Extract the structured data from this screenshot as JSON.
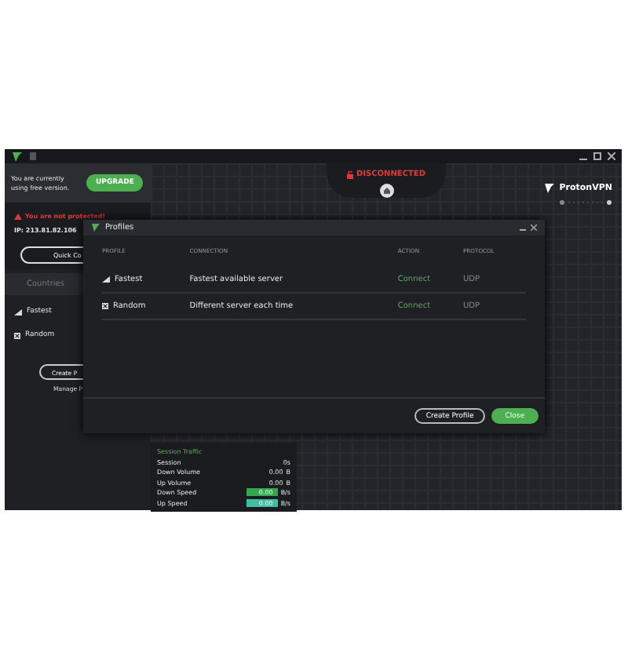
{
  "banner": {
    "text": "You are currently using free version.",
    "button": "UPGRADE"
  },
  "status": {
    "warning": "You are not protected!",
    "ip": "IP: 213.81.82.106",
    "quick_connect": "Quick Co"
  },
  "sidebar": {
    "tabs": [
      {
        "label": "Countries",
        "selected": false
      }
    ],
    "profiles": [
      {
        "name": "Fastest",
        "kind": "fastest"
      },
      {
        "name": "Random",
        "kind": "random"
      }
    ],
    "create_button": "Create P",
    "manage_link": "Manage P"
  },
  "connection": {
    "status": "DISCONNECTED"
  },
  "brand": "ProtonVPN",
  "stats": {
    "title": "Session Traffic",
    "rows": [
      {
        "label": "Session",
        "value": "0s",
        "kind": "plain"
      },
      {
        "label": "Down Volume",
        "value": "0.00",
        "unit": "B",
        "kind": "plain"
      },
      {
        "label": "Up Volume",
        "value": "0.00",
        "unit": "B",
        "kind": "plain"
      },
      {
        "label": "Down Speed",
        "value": "0.00",
        "unit": "B/s",
        "kind": "bar",
        "color": "#2fa84f"
      },
      {
        "label": "Up Speed",
        "value": "0.00",
        "unit": "B/s",
        "kind": "bar",
        "color": "#3fbf9f"
      }
    ]
  },
  "dialog": {
    "title": "Profiles",
    "columns": [
      "PROFILE",
      "CONNECTION",
      "ACTION",
      "PROTOCOL"
    ],
    "rows": [
      {
        "profile": "Fastest",
        "kind": "fastest",
        "connection": "Fastest available server",
        "action": "Connect",
        "protocol": "UDP"
      },
      {
        "profile": "Random",
        "kind": "random",
        "connection": "Different server each time",
        "action": "Connect",
        "protocol": "UDP"
      }
    ],
    "buttons": [
      {
        "label": "Create Profile",
        "kind": "secondary"
      },
      {
        "label": "Close",
        "kind": "primary"
      }
    ]
  }
}
